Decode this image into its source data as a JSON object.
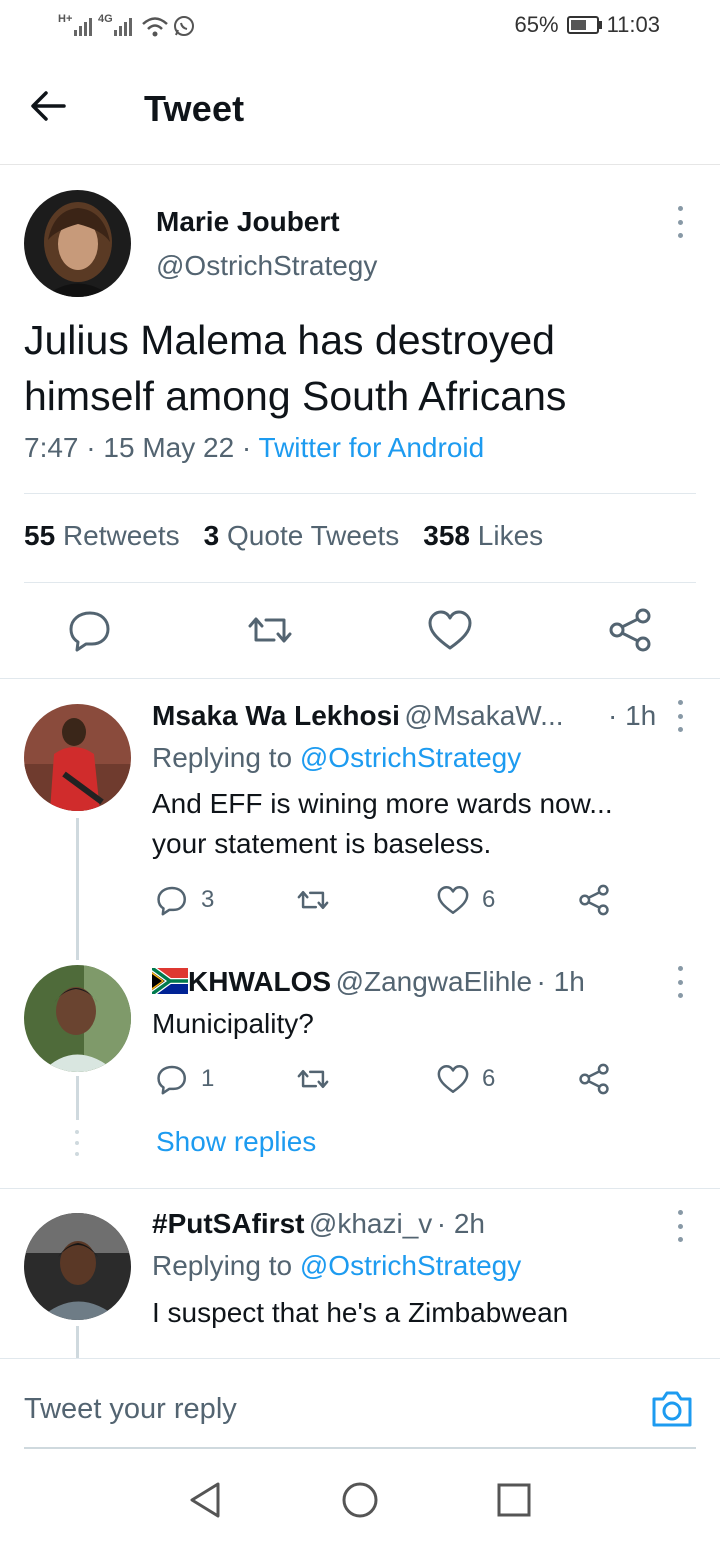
{
  "status_bar": {
    "signal1": "H+",
    "signal2": "4G",
    "battery": "65%",
    "battery_level": 0.65,
    "time": "11:03"
  },
  "header": {
    "title": "Tweet"
  },
  "tweet": {
    "name": "Marie Joubert",
    "handle": "@OstrichStrategy",
    "text": "Julius Malema has destroyed himself among South Africans",
    "time": "7:47",
    "sep1": " · ",
    "date": "15 May 22",
    "sep2": " · ",
    "source": "Twitter for Android",
    "retweets_count": "55",
    "retweets_label": "Retweets",
    "quotes_count": "3",
    "quotes_label": "Quote Tweets",
    "likes_count": "358",
    "likes_label": "Likes"
  },
  "replies": [
    {
      "name": "Msaka Wa Lekhosi",
      "handle": "@MsakaW...",
      "time": "· 1h",
      "replying_prefix": "Replying to",
      "replying_to": "@OstrichStrategy",
      "text_line1": "And EFF is wining more wards now...",
      "text_line2": "your statement is baseless.",
      "reply_count": "3",
      "like_count": "6"
    },
    {
      "name": "KHWALOS",
      "handle": "@ZangwaElihle",
      "time": "· 1h",
      "text": "Municipality?",
      "reply_count": "1",
      "like_count": "6",
      "show_replies": "Show replies"
    },
    {
      "name": "#PutSAfirst",
      "handle": "@khazi_v",
      "time": "· 2h",
      "replying_prefix": "Replying to",
      "replying_to": "@OstrichStrategy",
      "text": "I suspect that he's a Zimbabwean"
    }
  ],
  "composer": {
    "placeholder": "Tweet your reply"
  },
  "colors": {
    "accent": "#1d9bf0",
    "text": "#0f1419",
    "secondary": "#536471"
  }
}
